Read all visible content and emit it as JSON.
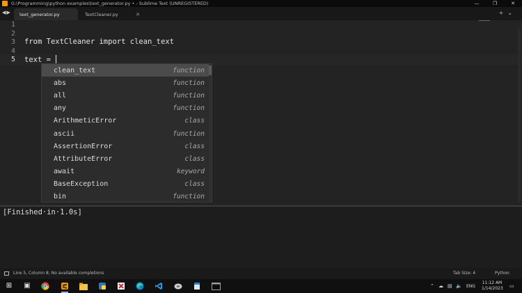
{
  "window": {
    "title": "G:\\Programming\\python examples\\text_generator.py • - Sublime Text (UNREGISTERED)",
    "controls": [
      "—",
      "❐",
      "✕"
    ]
  },
  "tabs": [
    {
      "label": "text_generator.py",
      "active": true
    },
    {
      "label": "TextCleaner.py",
      "active": false
    }
  ],
  "tab_tools": {
    "add": "+",
    "menu": "⌄"
  },
  "editor": {
    "line_numbers": [
      "1",
      "2",
      "3",
      "4",
      "5"
    ],
    "current_line": 5,
    "lines": {
      "l3_kw1": "from",
      "l3_mod": " TextCleaner ",
      "l3_kw2": "import",
      "l3_name": " clean_text",
      "l5": "text = "
    }
  },
  "autocomplete": {
    "items": [
      {
        "name": "clean_text",
        "kind": "function",
        "selected": true
      },
      {
        "name": "abs",
        "kind": "function"
      },
      {
        "name": "all",
        "kind": "function"
      },
      {
        "name": "any",
        "kind": "function"
      },
      {
        "name": "ArithmeticError",
        "kind": "class"
      },
      {
        "name": "ascii",
        "kind": "function"
      },
      {
        "name": "AssertionError",
        "kind": "class"
      },
      {
        "name": "AttributeError",
        "kind": "class"
      },
      {
        "name": "await",
        "kind": "keyword"
      },
      {
        "name": "BaseException",
        "kind": "class"
      },
      {
        "name": "bin",
        "kind": "function"
      }
    ]
  },
  "output": {
    "text": "[Finished·in·1.0s]"
  },
  "statusbar": {
    "message": "Line 5, Column 8; No available completions",
    "tab_size": "Tab Size: 4",
    "syntax": "Python"
  },
  "taskbar": {
    "lang": "ENG",
    "time": "11:12 AM",
    "date": "1/14/2023"
  },
  "colors": {
    "editor_bg": "#232323",
    "selected_item": "#4b4b4b",
    "accent": "#ff9800"
  }
}
